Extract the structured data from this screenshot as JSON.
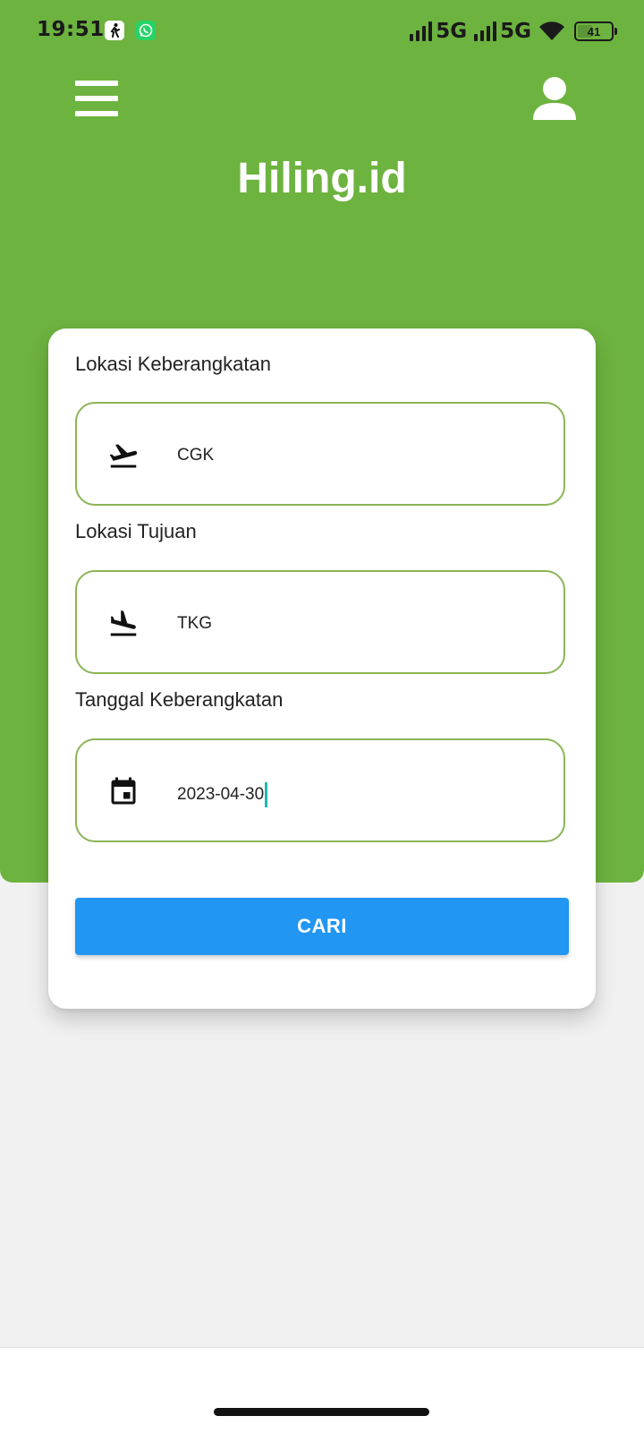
{
  "status_bar": {
    "time": "19:51",
    "notification_icons": [
      "running-person-app-icon",
      "whatsapp-icon"
    ],
    "network_1": "5G",
    "network_2": "5G",
    "battery": "41",
    "icons": [
      "signal-icon",
      "wifi-icon",
      "battery-icon"
    ]
  },
  "header": {
    "title": "Hiling.id",
    "icons": [
      "hamburger-menu-icon",
      "person-icon"
    ]
  },
  "form": {
    "departure": {
      "label": "Lokasi Keberangkatan",
      "value": "CGK",
      "icon": "flight-takeoff-icon"
    },
    "destination": {
      "label": "Lokasi Tujuan",
      "value": "TKG",
      "icon": "flight-land-icon"
    },
    "date": {
      "label": "Tanggal Keberangkatan",
      "value": "2023-04-30",
      "icon": "calendar-icon"
    },
    "search_label": "CARI"
  },
  "colors": {
    "header_green": "#6db33f",
    "field_border": "#8bb557",
    "button_blue": "#2196f3",
    "caret": "#1fb9b0"
  }
}
